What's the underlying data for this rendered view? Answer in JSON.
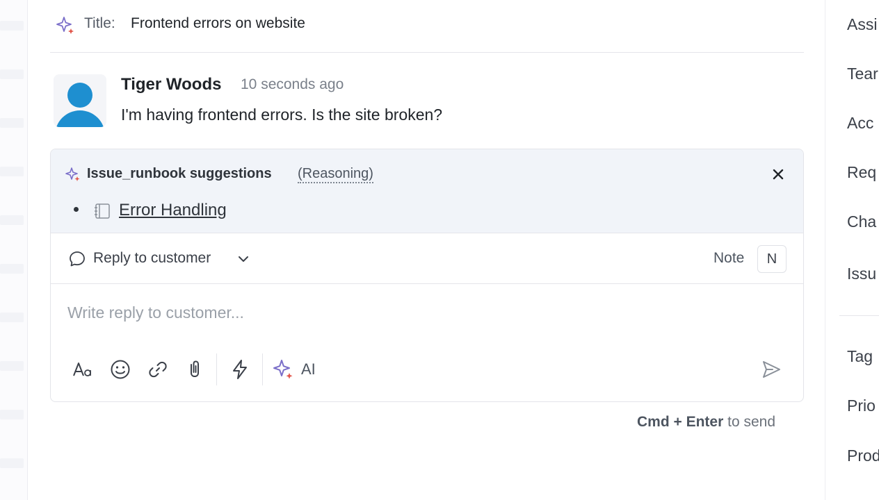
{
  "header": {
    "title_label": "Title:",
    "title_value": "Frontend errors on website"
  },
  "message": {
    "author": "Tiger Woods",
    "timestamp": "10 seconds ago",
    "text": "I'm having frontend errors. Is the site broken?"
  },
  "suggestions": {
    "title": "Issue_runbook suggestions",
    "reasoning_label": "(Reasoning)",
    "items": [
      {
        "label": "Error Handling",
        "icon": "notebook-icon"
      }
    ]
  },
  "reply": {
    "mode_label": "Reply to customer",
    "note_label": "Note",
    "note_shortcut": "N",
    "placeholder": "Write reply to customer...",
    "ai_label": "AI",
    "toolbar_icons": [
      "text-format-icon",
      "emoji-icon",
      "link-icon",
      "attachment-icon",
      "lightning-icon",
      "ai-sparkle-icon",
      "send-icon"
    ]
  },
  "send_hint": {
    "keys": "Cmd + Enter",
    "suffix": " to send"
  },
  "right_panel": {
    "items": [
      "Assi",
      "Tear",
      "Acc",
      "Req",
      "Cha",
      "Issu",
      "Tag",
      "Prio",
      "Prod"
    ]
  },
  "colors": {
    "avatar": "#1e8fd0",
    "sparkle_purple": "#7b6fc9",
    "sparkle_red": "#e2574c",
    "suggestion_bg": "#f1f4f9"
  }
}
